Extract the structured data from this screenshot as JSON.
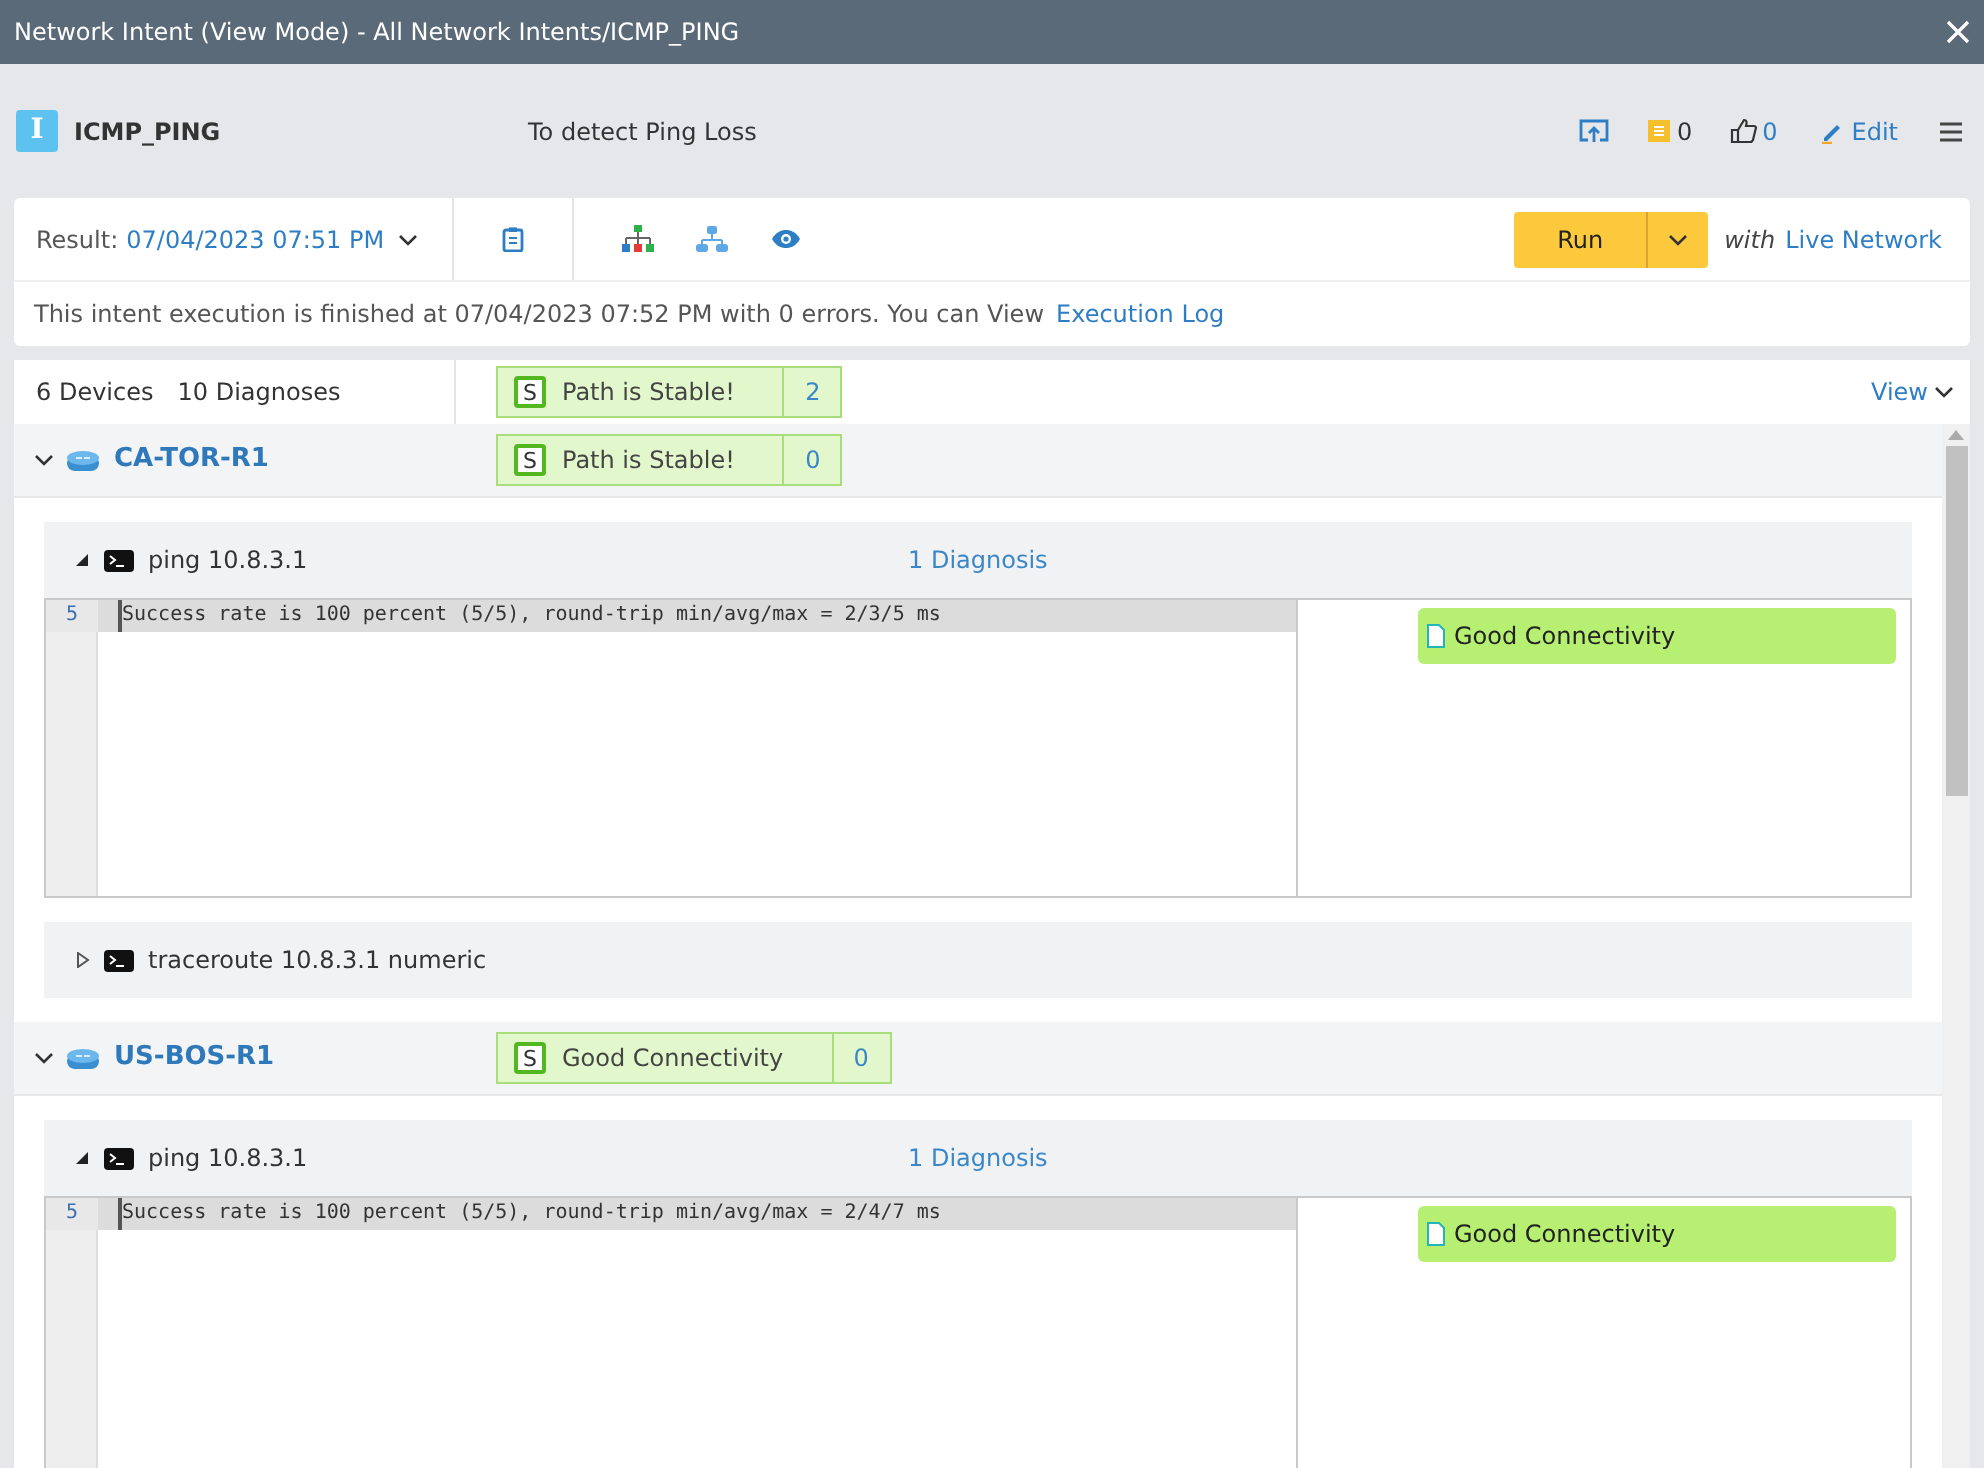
{
  "window": {
    "title": "Network Intent (View Mode) - All Network Intents/ICMP_PING"
  },
  "intent": {
    "badge": "I",
    "name": "ICMP_PING",
    "description": "To detect Ping Loss",
    "comments": "0",
    "likes": "0",
    "edit": "Edit"
  },
  "toolbar": {
    "result_label": "Result:",
    "result_value": "07/04/2023 07:51 PM",
    "run": "Run",
    "with": "with",
    "network": "Live Network"
  },
  "message": {
    "text": "This intent execution is finished at 07/04/2023 07:52 PM with 0 errors. You can View",
    "link": "Execution Log"
  },
  "summary": {
    "devices": "6 Devices",
    "diagnoses": "10 Diagnoses",
    "status_letter": "S",
    "status": "Path is Stable!",
    "count": "2",
    "view": "View"
  },
  "devices": [
    {
      "name": "CA-TOR-R1",
      "expanded": true,
      "status_letter": "S",
      "status": "Path is Stable!",
      "count": "0",
      "commands": [
        {
          "command": "ping 10.8.3.1",
          "expanded": true,
          "diagnosis": "1 Diagnosis",
          "lines": [
            {
              "number": "5",
              "text": "Success rate is 100 percent (5/5), round-trip min/avg/max = 2/3/5 ms"
            }
          ],
          "labels": [
            "Good Connectivity"
          ]
        },
        {
          "command": "traceroute 10.8.3.1 numeric",
          "expanded": false
        }
      ]
    },
    {
      "name": "US-BOS-R1",
      "expanded": true,
      "status_letter": "S",
      "status": "Good Connectivity",
      "count": "0",
      "commands": [
        {
          "command": "ping 10.8.3.1",
          "expanded": true,
          "diagnosis": "1 Diagnosis",
          "lines": [
            {
              "number": "5",
              "text": "Success rate is 100 percent (5/5), round-trip min/avg/max = 2/4/7 ms"
            }
          ],
          "labels": [
            "Good Connectivity"
          ]
        }
      ]
    }
  ]
}
